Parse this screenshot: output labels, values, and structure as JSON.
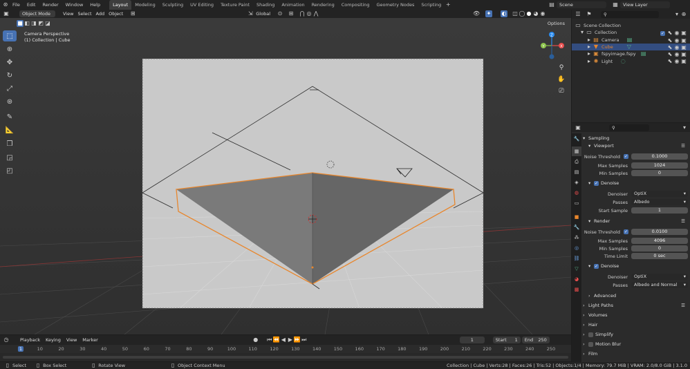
{
  "topbar": {
    "menus": [
      "File",
      "Edit",
      "Render",
      "Window",
      "Help"
    ],
    "workspaces": [
      "Layout",
      "Modeling",
      "Sculpting",
      "UV Editing",
      "Texture Paint",
      "Shading",
      "Animation",
      "Rendering",
      "Compositing",
      "Geometry Nodes",
      "Scripting"
    ],
    "scene": "Scene",
    "view_layer": "View Layer"
  },
  "viewport": {
    "mode": "Object Mode",
    "menus": [
      "View",
      "Select",
      "Add",
      "Object"
    ],
    "orientation": "Global",
    "options": "Options",
    "camera_label": "Camera Perspective",
    "collection_label": "(1) Collection | Cube",
    "gizmo": {
      "x": "X",
      "y": "Y",
      "z": "Z"
    }
  },
  "outliner": {
    "items": [
      {
        "label": "Scene Collection",
        "indent": 0
      },
      {
        "label": "Collection",
        "indent": 1
      },
      {
        "label": "Camera",
        "indent": 2
      },
      {
        "label": "Cube",
        "indent": 2,
        "selected": true
      },
      {
        "label": "fspyimage.fspy",
        "indent": 2
      },
      {
        "label": "Light",
        "indent": 2
      }
    ]
  },
  "properties": {
    "sampling": "Sampling",
    "viewport": "Viewport",
    "vp_noise_label": "Noise Threshold",
    "vp_noise": "0.1000",
    "vp_max_label": "Max Samples",
    "vp_max": "1024",
    "vp_min_label": "Min Samples",
    "vp_min": "0",
    "denoise": "Denoise",
    "denoiser_label": "Denoiser",
    "denoiser": "OptiX",
    "passes_label": "Passes",
    "vp_passes": "Albedo",
    "start_sample_label": "Start Sample",
    "start_sample": "1",
    "render": "Render",
    "r_noise": "0.0100",
    "r_max": "4096",
    "r_min": "0",
    "time_limit_label": "Time Limit",
    "time_limit": "0 sec",
    "r_denoiser": "OptiX",
    "r_passes": "Albedo and Normal",
    "advanced": "Advanced",
    "light_paths": "Light Paths",
    "volumes": "Volumes",
    "hair": "Hair",
    "simplify": "Simplify",
    "motion_blur": "Motion Blur",
    "film": "Film"
  },
  "timeline": {
    "menus": [
      "Playback",
      "Keying",
      "View",
      "Marker"
    ],
    "current_frame": "1",
    "start_label": "Start",
    "start": "1",
    "end_label": "End",
    "end": "250",
    "ticks": [
      "1",
      "10",
      "20",
      "30",
      "40",
      "50",
      "60",
      "70",
      "80",
      "90",
      "100",
      "110",
      "120",
      "130",
      "140",
      "150",
      "160",
      "170",
      "180",
      "190",
      "200",
      "210",
      "220",
      "230",
      "240",
      "250"
    ]
  },
  "statusbar": {
    "select": "Select",
    "box_select": "Box Select",
    "rotate_view": "Rotate View",
    "context_menu": "Object Context Menu",
    "stats": "Collection | Cube | Verts:28 | Faces:26 | Tris:52 | Objects:1/4 | Memory: 79.7 MiB | VRAM: 2.0/8.0 GiB | 3.1.0"
  },
  "colors": {
    "accent": "#4772b3",
    "selection": "#e8862c",
    "x_axis": "#e84d4d",
    "y_axis": "#8bc34a",
    "z_axis": "#2a8cf0"
  }
}
